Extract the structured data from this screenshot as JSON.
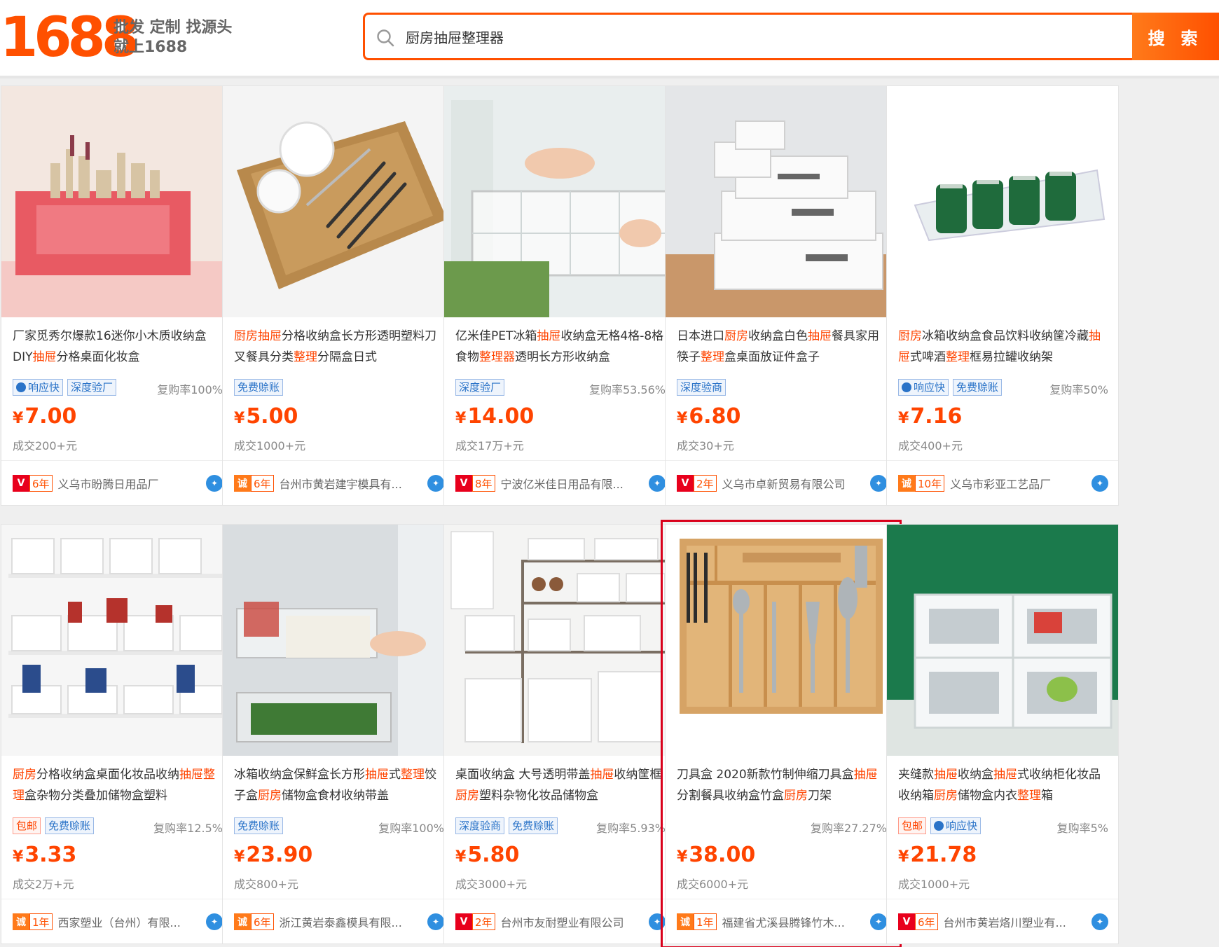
{
  "header": {
    "logo": "1688",
    "slogan_line1": "批发 定制 找源头",
    "slogan_line2": "就上1688",
    "search_value": "厨房抽屉整理器",
    "search_button": "搜 索"
  },
  "products": [
    {
      "title_parts": [
        {
          "t": "厂家觅秀尔爆款16迷你小木质收纳盒DIY"
        },
        {
          "t": "抽屉",
          "hl": true
        },
        {
          "t": "分格桌面化妆盒"
        }
      ],
      "tags": [
        {
          "label": "响应快",
          "style": "blue-solid",
          "dot": true
        },
        {
          "label": "深度验厂",
          "style": "blue"
        }
      ],
      "repeat": "复购率100%",
      "price": "7.00",
      "deal": "成交200+元",
      "badge": "red",
      "badge_char": "V",
      "years": "6年",
      "shop": "义乌市盼腾日用品厂",
      "image": "cosmetic-box"
    },
    {
      "title_parts": [
        {
          "t": "厨房抽屉",
          "hl": true
        },
        {
          "t": "分格收纳盒长方形透明塑料刀叉餐具分类"
        },
        {
          "t": "整理",
          "hl": true
        },
        {
          "t": "分隔盒日式"
        }
      ],
      "tags": [
        {
          "label": "免费赊账",
          "style": "blue"
        }
      ],
      "repeat": "",
      "price": "5.00",
      "deal": "成交1000+元",
      "badge": "gold",
      "badge_char": "诚",
      "years": "6年",
      "shop": "台州市黄岩建宇模具有...",
      "image": "drawer-organizer"
    },
    {
      "title_parts": [
        {
          "t": "亿米佳PET冰箱"
        },
        {
          "t": "抽屉",
          "hl": true
        },
        {
          "t": "收纳盒无格4格-8格食物"
        },
        {
          "t": "整理器",
          "hl": true
        },
        {
          "t": "透明长方形收纳盒"
        }
      ],
      "tags": [
        {
          "label": "深度验厂",
          "style": "blue"
        }
      ],
      "repeat": "复购率53.56%",
      "price": "14.00",
      "deal": "成交17万+元",
      "badge": "red",
      "badge_char": "V",
      "years": "8年",
      "shop": "宁波亿米佳日用品有限...",
      "image": "fridge-drawer"
    },
    {
      "title_parts": [
        {
          "t": "日本进口"
        },
        {
          "t": "厨房",
          "hl": true
        },
        {
          "t": "收纳盒白色"
        },
        {
          "t": "抽屉",
          "hl": true
        },
        {
          "t": "餐具家用筷子"
        },
        {
          "t": "整理",
          "hl": true
        },
        {
          "t": "盒桌面放证件盒子"
        }
      ],
      "tags": [
        {
          "label": "深度验商",
          "style": "blue"
        }
      ],
      "repeat": "",
      "price": "6.80",
      "deal": "成交30+元",
      "badge": "red",
      "badge_char": "V",
      "years": "2年",
      "shop": "义乌市卓新贸易有限公司",
      "image": "storage-case"
    },
    {
      "title_parts": [
        {
          "t": "厨房",
          "hl": true
        },
        {
          "t": "冰箱收纳盒食品饮料收纳筐冷藏"
        },
        {
          "t": "抽屉",
          "hl": true
        },
        {
          "t": "式啤酒"
        },
        {
          "t": "整理",
          "hl": true
        },
        {
          "t": "框易拉罐收纳架"
        }
      ],
      "tags": [
        {
          "label": "响应快",
          "style": "blue-solid",
          "dot": true
        },
        {
          "label": "免费赊账",
          "style": "blue"
        }
      ],
      "repeat": "复购率50%",
      "price": "7.16",
      "deal": "成交400+元",
      "badge": "gold",
      "badge_char": "诚",
      "years": "10年",
      "shop": "义乌市彩亚工艺品厂",
      "image": "can-rack"
    },
    {
      "title_parts": [
        {
          "t": "厨房",
          "hl": true
        },
        {
          "t": "分格收纳盒桌面化妆品收纳"
        },
        {
          "t": "抽屉",
          "hl": true
        },
        {
          "t": "整理",
          "hl": true
        },
        {
          "t": "盒杂物分类叠加储物盒塑料"
        }
      ],
      "tags": [
        {
          "label": "包邮",
          "style": "red"
        },
        {
          "label": "免费赊账",
          "style": "blue"
        }
      ],
      "repeat": "复购率12.5%",
      "price": "3.33",
      "deal": "成交2万+元",
      "badge": "gold",
      "badge_char": "诚",
      "years": "1年",
      "shop": "西家塑业（台州）有限...",
      "image": "pantry-shelf"
    },
    {
      "title_parts": [
        {
          "t": "冰箱收纳盒保鲜盒长方形"
        },
        {
          "t": "抽屉",
          "hl": true
        },
        {
          "t": "式"
        },
        {
          "t": "整理",
          "hl": true
        },
        {
          "t": "饺子盒"
        },
        {
          "t": "厨房",
          "hl": true
        },
        {
          "t": "储物盒食材收纳带盖"
        }
      ],
      "tags": [
        {
          "label": "免费赊账",
          "style": "blue"
        }
      ],
      "repeat": "复购率100%",
      "price": "23.90",
      "deal": "成交800+元",
      "badge": "gold",
      "badge_char": "诚",
      "years": "6年",
      "shop": "浙江黄岩泰鑫模具有限...",
      "image": "fridge-box"
    },
    {
      "title_parts": [
        {
          "t": "桌面收纳盒 大号透明带盖"
        },
        {
          "t": "抽屉",
          "hl": true
        },
        {
          "t": "收纳筐框 "
        },
        {
          "t": "厨房",
          "hl": true
        },
        {
          "t": "塑料杂物化妆品储物盒"
        }
      ],
      "tags": [
        {
          "label": "深度验商",
          "style": "blue"
        },
        {
          "label": "免费赊账",
          "style": "blue"
        }
      ],
      "repeat": "复购率5.93%",
      "price": "5.80",
      "deal": "成交3000+元",
      "badge": "red",
      "badge_char": "V",
      "years": "2年",
      "shop": "台州市友耐塑业有限公司",
      "image": "white-bins"
    },
    {
      "title_parts": [
        {
          "t": "刀具盒 2020新款竹制伸缩刀具盒"
        },
        {
          "t": "抽屉",
          "hl": true
        },
        {
          "t": "分割餐具收纳盒竹盒"
        },
        {
          "t": "厨房",
          "hl": true
        },
        {
          "t": "刀架"
        }
      ],
      "tags": [],
      "repeat": "复购率27.27%",
      "price": "38.00",
      "deal": "成交6000+元",
      "badge": "gold",
      "badge_char": "诚",
      "years": "1年",
      "shop": "福建省尤溪县腾锋竹木...",
      "image": "bamboo-tray",
      "highlight": true
    },
    {
      "title_parts": [
        {
          "t": "夹缝款"
        },
        {
          "t": "抽屉",
          "hl": true
        },
        {
          "t": "收纳盒"
        },
        {
          "t": "抽屉",
          "hl": true
        },
        {
          "t": "式收纳柜化妆品收纳箱"
        },
        {
          "t": "厨房",
          "hl": true
        },
        {
          "t": "储物盒内衣"
        },
        {
          "t": "整理",
          "hl": true
        },
        {
          "t": "箱"
        }
      ],
      "tags": [
        {
          "label": "包邮",
          "style": "red"
        },
        {
          "label": "响应快",
          "style": "blue-solid",
          "dot": true
        }
      ],
      "repeat": "复购率5%",
      "price": "21.78",
      "deal": "成交1000+元",
      "badge": "red",
      "badge_char": "V",
      "years": "6年",
      "shop": "台州市黄岩烙川塑业有...",
      "image": "plastic-drawers"
    }
  ],
  "currency_symbol": "¥",
  "ww_icon": "wangwang-chat-icon"
}
